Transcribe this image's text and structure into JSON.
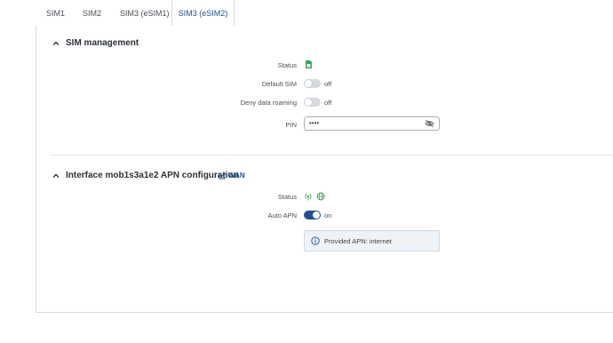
{
  "tabs": [
    "SIM1",
    "SIM2",
    "SIM3 (eSIM1)",
    "SIM3 (eSIM2)"
  ],
  "active_tab": "SIM3 (eSIM2)",
  "sim_management": {
    "title": "SIM management",
    "status_label": "Status",
    "status_icon": "sim-card-icon",
    "default_sim_label": "Default SIM",
    "default_sim_value": "off",
    "deny_roaming_label": "Deny data roaming",
    "deny_roaming_value": "off",
    "pin_label": "PIN",
    "pin_value": "••••"
  },
  "apn": {
    "title": "Interface mob1s3a1e2 APN configuration",
    "link_label": "WAN",
    "status_label": "Status",
    "auto_apn_label": "Auto APN",
    "auto_apn_value": "on",
    "info_text": "Provided APN: internet"
  },
  "colors": {
    "accent": "#1e4f91",
    "status_green": "#3aa35a"
  }
}
